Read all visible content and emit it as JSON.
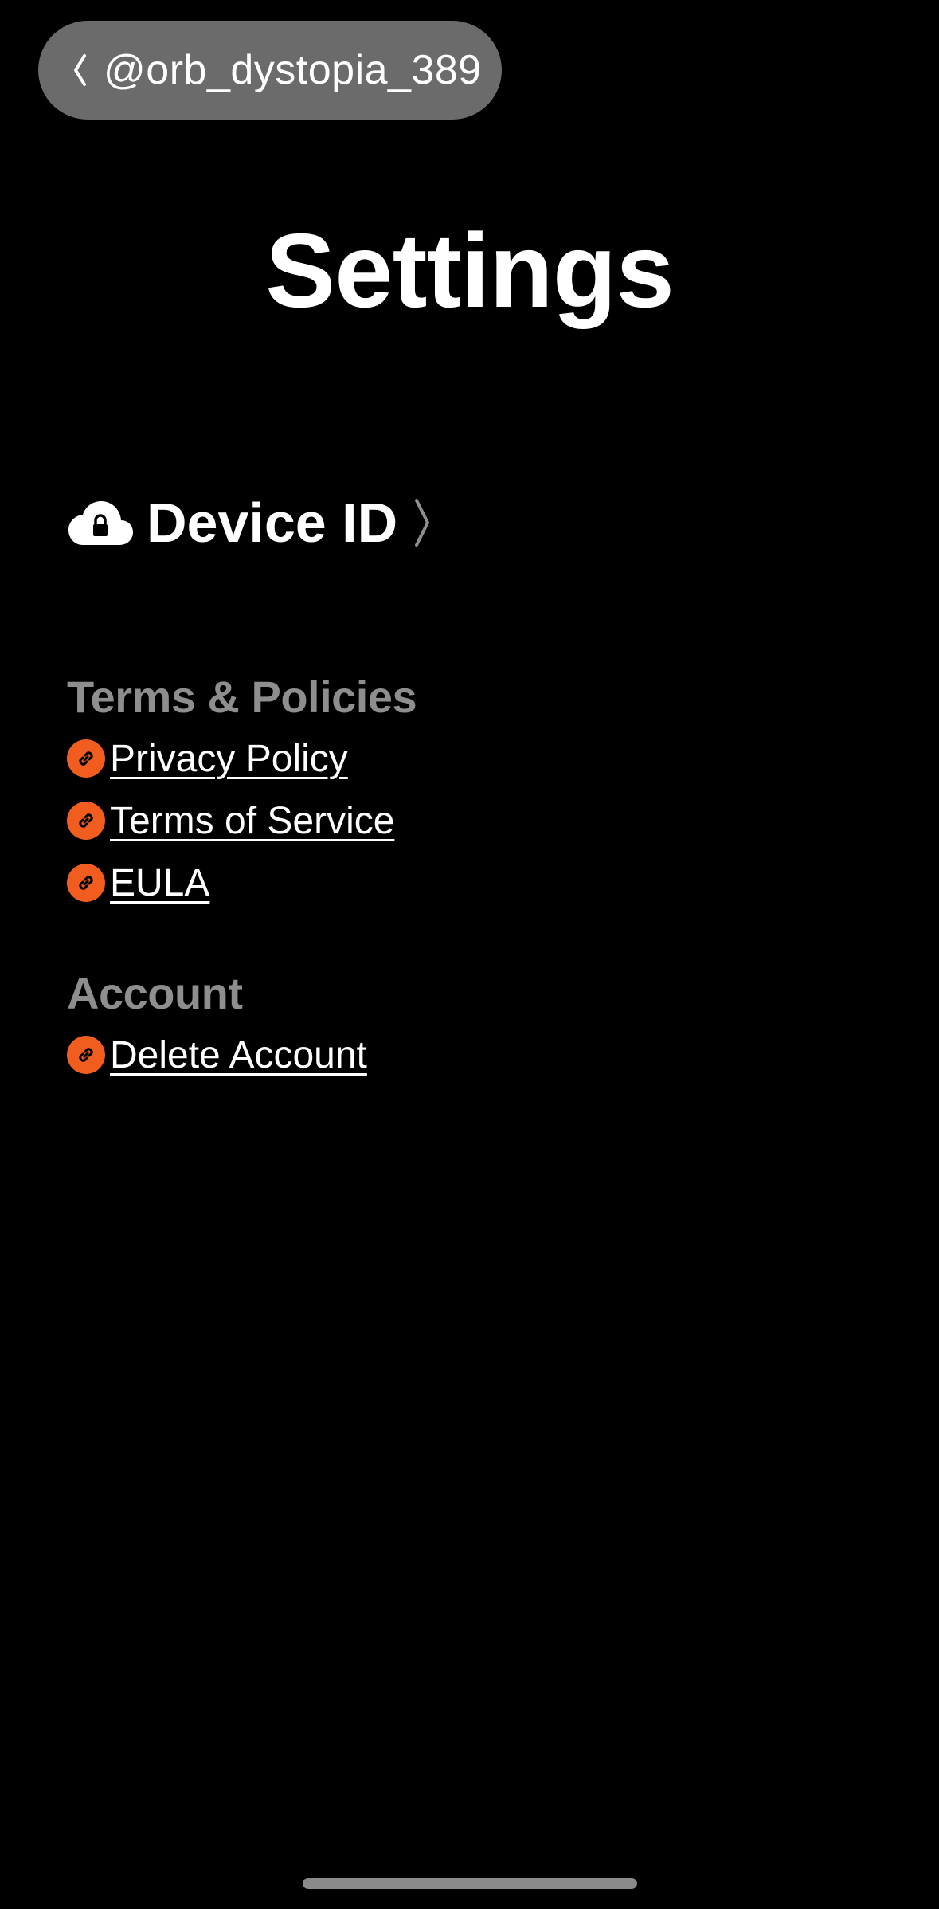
{
  "header": {
    "back_label": "@orb_dystopia_389",
    "title": "Settings"
  },
  "device": {
    "label": "Device ID",
    "icon": "cloud-lock-icon"
  },
  "sections": {
    "terms": {
      "title": "Terms & Policies",
      "items": [
        "Privacy Policy",
        "Terms of Service",
        "EULA"
      ]
    },
    "account": {
      "title": "Account",
      "items": [
        "Delete Account"
      ]
    }
  },
  "colors": {
    "background": "#000000",
    "pill": "#6b6b6b",
    "section_header": "#8e8e8e",
    "link_badge": "#f05d1e",
    "text": "#ffffff"
  },
  "icons": {
    "back": "chevron-left-icon",
    "forward": "chevron-right-icon",
    "link": "link-icon"
  }
}
